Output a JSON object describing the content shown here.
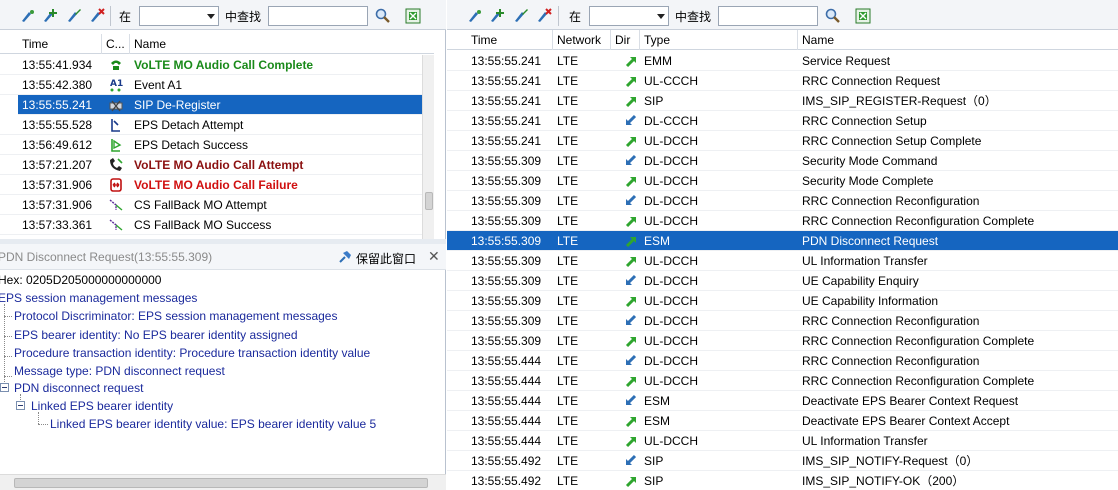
{
  "left_toolbar": {
    "label_in": "在",
    "label_find": "中查找",
    "combo_value": "",
    "search_value": ""
  },
  "right_toolbar": {
    "label_in": "在",
    "label_find": "中查找",
    "combo_value": "",
    "search_value": ""
  },
  "events": {
    "columns": [
      "Time",
      "C...",
      "Name"
    ],
    "rows": [
      {
        "time": "13:55:41.934",
        "icon": "phone-green-icon",
        "name": "VoLTE MO Audio Call Complete",
        "style": "green",
        "selected": false
      },
      {
        "time": "13:55:42.380",
        "icon": "event-a1-icon",
        "name": "Event A1",
        "style": "",
        "selected": false
      },
      {
        "time": "13:55:55.241",
        "icon": "sip-deregister-icon",
        "name": "SIP De-Register",
        "style": "",
        "selected": true
      },
      {
        "time": "13:55:55.528",
        "icon": "eps-detach-attempt-icon",
        "name": "EPS Detach Attempt",
        "style": "",
        "selected": false
      },
      {
        "time": "13:56:49.612",
        "icon": "eps-detach-success-icon",
        "name": "EPS Detach Success",
        "style": "",
        "selected": false
      },
      {
        "time": "13:57:21.207",
        "icon": "phone-attempt-icon",
        "name": "VoLTE MO Audio Call Attempt",
        "style": "darkred",
        "selected": false
      },
      {
        "time": "13:57:31.906",
        "icon": "phone-failure-icon",
        "name": "VoLTE MO Audio Call Failure",
        "style": "red",
        "selected": false
      },
      {
        "time": "13:57:31.906",
        "icon": "cs-fallback-icon",
        "name": "CS FallBack MO Attempt",
        "style": "",
        "selected": false
      },
      {
        "time": "13:57:33.361",
        "icon": "cs-fallback-icon",
        "name": "CS FallBack MO Success",
        "style": "",
        "selected": false
      }
    ]
  },
  "detail": {
    "title": "PDN Disconnect Request(13:55:55.309)",
    "keep_window_label": "保留此窗口",
    "hex_line": "Hex:  0205D205000000000000",
    "tree": [
      "EPS session management messages",
      "Protocol Discriminator:  EPS session management messages",
      "EPS bearer identity:  No EPS bearer identity assigned",
      "Procedure transaction identity:  Procedure transaction identity value",
      "Message type:  PDN disconnect request",
      "PDN disconnect request",
      "Linked EPS bearer identity",
      "Linked EPS bearer identity value:  EPS bearer identity value 5"
    ]
  },
  "messages": {
    "columns": [
      "Time",
      "Network",
      "Dir",
      "Type",
      "Name"
    ],
    "rows": [
      {
        "time": "13:55:55.241",
        "network": "LTE",
        "dir": "up",
        "type": "EMM",
        "name": "Service Request",
        "selected": false
      },
      {
        "time": "13:55:55.241",
        "network": "LTE",
        "dir": "up",
        "type": "UL-CCCH",
        "name": "RRC Connection Request",
        "selected": false
      },
      {
        "time": "13:55:55.241",
        "network": "LTE",
        "dir": "up",
        "type": "SIP",
        "name": "IMS_SIP_REGISTER-Request（0）",
        "selected": false
      },
      {
        "time": "13:55:55.241",
        "network": "LTE",
        "dir": "down",
        "type": "DL-CCCH",
        "name": "RRC Connection Setup",
        "selected": false
      },
      {
        "time": "13:55:55.241",
        "network": "LTE",
        "dir": "up",
        "type": "UL-DCCH",
        "name": "RRC Connection Setup Complete",
        "selected": false
      },
      {
        "time": "13:55:55.309",
        "network": "LTE",
        "dir": "down",
        "type": "DL-DCCH",
        "name": "Security Mode Command",
        "selected": false
      },
      {
        "time": "13:55:55.309",
        "network": "LTE",
        "dir": "up",
        "type": "UL-DCCH",
        "name": "Security Mode Complete",
        "selected": false
      },
      {
        "time": "13:55:55.309",
        "network": "LTE",
        "dir": "down",
        "type": "DL-DCCH",
        "name": "RRC Connection Reconfiguration",
        "selected": false
      },
      {
        "time": "13:55:55.309",
        "network": "LTE",
        "dir": "up",
        "type": "UL-DCCH",
        "name": "RRC Connection Reconfiguration Complete",
        "selected": false
      },
      {
        "time": "13:55:55.309",
        "network": "LTE",
        "dir": "up",
        "type": "ESM",
        "name": "PDN Disconnect Request",
        "selected": true
      },
      {
        "time": "13:55:55.309",
        "network": "LTE",
        "dir": "up",
        "type": "UL-DCCH",
        "name": "UL Information Transfer",
        "selected": false
      },
      {
        "time": "13:55:55.309",
        "network": "LTE",
        "dir": "down",
        "type": "DL-DCCH",
        "name": "UE Capability Enquiry",
        "selected": false
      },
      {
        "time": "13:55:55.309",
        "network": "LTE",
        "dir": "up",
        "type": "UL-DCCH",
        "name": "UE Capability Information",
        "selected": false
      },
      {
        "time": "13:55:55.309",
        "network": "LTE",
        "dir": "down",
        "type": "DL-DCCH",
        "name": "RRC Connection Reconfiguration",
        "selected": false
      },
      {
        "time": "13:55:55.309",
        "network": "LTE",
        "dir": "up",
        "type": "UL-DCCH",
        "name": "RRC Connection Reconfiguration Complete",
        "selected": false
      },
      {
        "time": "13:55:55.444",
        "network": "LTE",
        "dir": "down",
        "type": "DL-DCCH",
        "name": "RRC Connection Reconfiguration",
        "selected": false
      },
      {
        "time": "13:55:55.444",
        "network": "LTE",
        "dir": "up",
        "type": "UL-DCCH",
        "name": "RRC Connection Reconfiguration Complete",
        "selected": false
      },
      {
        "time": "13:55:55.444",
        "network": "LTE",
        "dir": "down",
        "type": "ESM",
        "name": "Deactivate EPS Bearer Context Request",
        "selected": false
      },
      {
        "time": "13:55:55.444",
        "network": "LTE",
        "dir": "up",
        "type": "ESM",
        "name": "Deactivate EPS Bearer Context Accept",
        "selected": false
      },
      {
        "time": "13:55:55.444",
        "network": "LTE",
        "dir": "up",
        "type": "UL-DCCH",
        "name": "UL Information Transfer",
        "selected": false
      },
      {
        "time": "13:55:55.492",
        "network": "LTE",
        "dir": "down",
        "type": "SIP",
        "name": "IMS_SIP_NOTIFY-Request（0）",
        "selected": false
      },
      {
        "time": "13:55:55.492",
        "network": "LTE",
        "dir": "up",
        "type": "SIP",
        "name": "IMS_SIP_NOTIFY-OK（200）",
        "selected": false
      }
    ]
  },
  "colors": {
    "selection": "#1565c0",
    "arrow_up": "#2fa52f",
    "arrow_down": "#2d6fb5",
    "tree_text": "#1b2a9c"
  }
}
